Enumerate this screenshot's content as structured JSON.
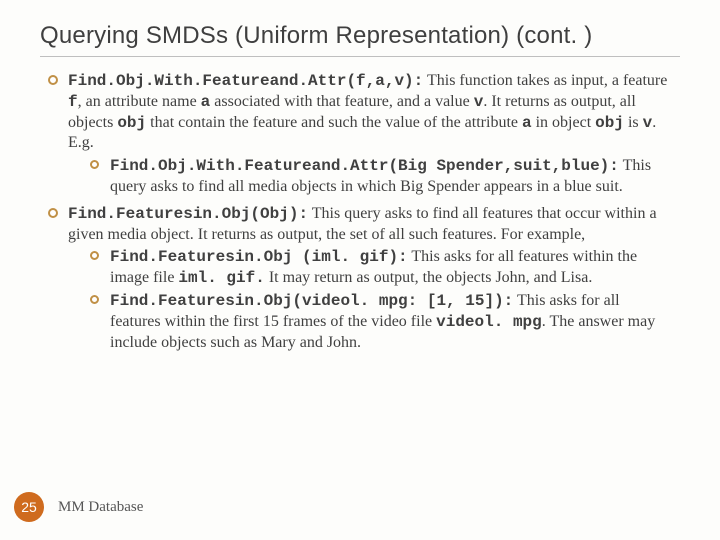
{
  "title": "Querying SMDSs (Uniform Representation) (cont. )",
  "b1_code": "Find.Obj.With.Featureand.Attr(f,a,v):",
  "b1_t1": " This function takes as input, a feature ",
  "b1_c1": "f",
  "b1_t2": ", an attribute name ",
  "b1_c2": "a",
  "b1_t3": " associated with that feature, and a value ",
  "b1_c3": "v",
  "b1_t4": ". It returns as output, all objects ",
  "b1_c4": "obj",
  "b1_t5": " that contain the feature and such the value of the attribute ",
  "b1_c5": "a",
  "b1_t6": " in object ",
  "b1_c6": "obj",
  "b1_t7": " is ",
  "b1_c7": "v",
  "b1_t8": ". E.g.",
  "b1s_code": "Find.Obj.With.Featureand.Attr(Big Spender,suit,blue):",
  "b1s_t1": " This query asks to find all media objects in which Big Spender appears in a blue suit.",
  "b2_code": "Find.Featuresin.Obj(Obj):",
  "b2_t1": " This query asks to find all features that occur within a given media object. It returns as output, the set of all such features. For example,",
  "b2s1_code": "Find.Featuresin.Obj (iml. gif):",
  "b2s1_t1": " This asks for all features within the image file ",
  "b2s1_c1": "iml. gif.",
  "b2s1_t2": " It may return as output, the objects John, and Lisa.",
  "b2s2_code": "Find.Featuresin.Obj(videol. mpg: [1, 15]):",
  "b2s2_t1": " This asks for all features within the first 15 frames of the video file ",
  "b2s2_c1": "videol. mpg",
  "b2s2_t2": ". The answer may include objects such as Mary and John.",
  "page_number": "25",
  "footer_label": "MM Database"
}
